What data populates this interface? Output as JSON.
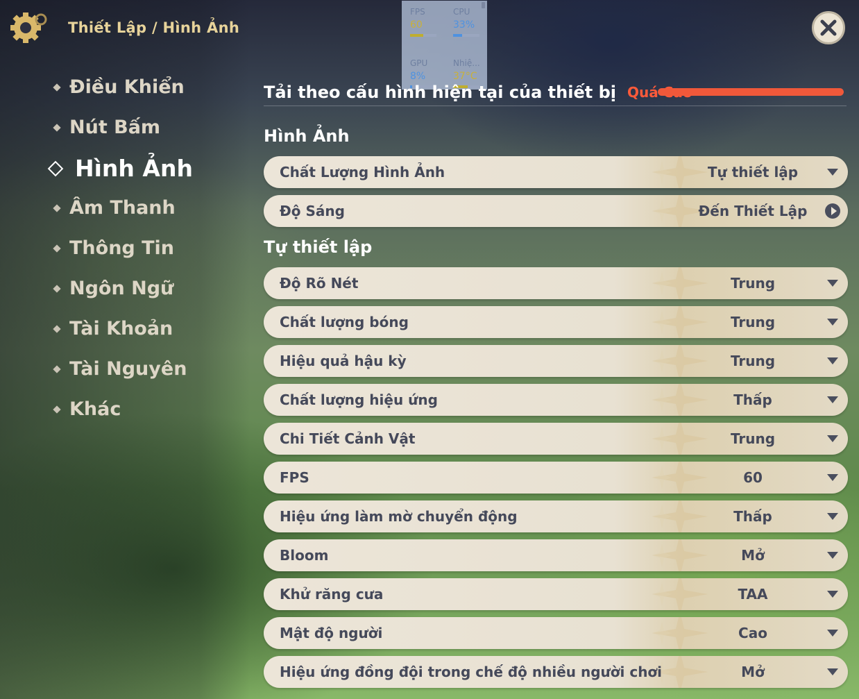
{
  "header": {
    "breadcrumb": "Thiết Lập / Hình Ảnh"
  },
  "perf": {
    "fps": {
      "label": "FPS",
      "value": "60",
      "level": 0.5
    },
    "cpu": {
      "label": "CPU",
      "value": "33%",
      "level": 0.33
    },
    "gpu": {
      "label": "GPU",
      "value": "8%",
      "level": 0.08
    },
    "temp": {
      "label": "Nhiệ...",
      "value": "37°C",
      "level": 0.55
    }
  },
  "sidebar": {
    "items": [
      {
        "label": "Điều Khiển"
      },
      {
        "label": "Nút Bấm"
      },
      {
        "label": "Hình Ảnh"
      },
      {
        "label": "Âm Thanh"
      },
      {
        "label": "Thông Tin"
      },
      {
        "label": "Ngôn Ngữ"
      },
      {
        "label": "Tài Khoản"
      },
      {
        "label": "Tài Nguyên"
      },
      {
        "label": "Khác"
      }
    ],
    "active_index": 2
  },
  "load": {
    "label": "Tải theo cấu hình hiện tại của thiết bị",
    "value": "Quá Cao",
    "level": 1.0,
    "color": "#f0583a"
  },
  "sections": {
    "graphics": "Hình Ảnh",
    "custom": "Tự thiết lập"
  },
  "graphics_rows": [
    {
      "name": "Chất Lượng Hình Ảnh",
      "value": "Tự thiết lập"
    },
    {
      "name": "Độ Sáng",
      "value": "Đến Thiết Lập"
    }
  ],
  "custom_rows": [
    {
      "name": "Độ Rõ Nét",
      "value": "Trung"
    },
    {
      "name": "Chất lượng bóng",
      "value": "Trung"
    },
    {
      "name": "Hiệu quả hậu kỳ",
      "value": "Trung"
    },
    {
      "name": "Chất lượng hiệu ứng",
      "value": "Thấp"
    },
    {
      "name": "Chi Tiết Cảnh Vật",
      "value": "Trung"
    },
    {
      "name": "FPS",
      "value": "60"
    },
    {
      "name": "Hiệu ứng làm mờ chuyển động",
      "value": "Thấp"
    },
    {
      "name": "Bloom",
      "value": "Mở"
    },
    {
      "name": "Khử răng cưa",
      "value": "TAA"
    },
    {
      "name": "Mật độ người",
      "value": "Cao"
    },
    {
      "name": "Hiệu ứng đồng đội trong chế độ nhiều người chơi",
      "value": "Mở"
    }
  ],
  "icons": {
    "settings": "gear-icon",
    "close": "close-icon",
    "dropdown": "chevron-down-icon",
    "goto": "arrow-right-icon"
  },
  "colors": {
    "accent_gold": "#e7d39a",
    "warning": "#ff5a3a",
    "row_text": "#45495a"
  }
}
